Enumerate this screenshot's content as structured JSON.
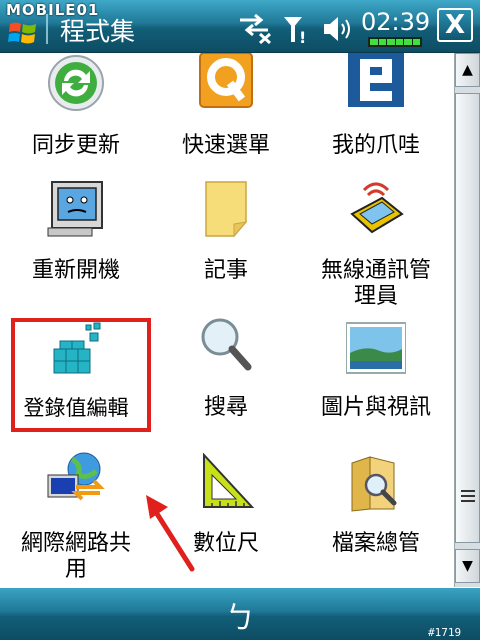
{
  "watermark": "MOBILE01",
  "title_bar": {
    "app_title": "程式集",
    "clock": "02:39",
    "close_label": "X"
  },
  "tiles": [
    {
      "id": "sync",
      "label": "同步更新",
      "icon": "sync-icon"
    },
    {
      "id": "quickmenu",
      "label": "快速選單",
      "icon": "quick-menu-icon"
    },
    {
      "id": "mywawa",
      "label": "我的爪哇",
      "icon": "java-icon"
    },
    {
      "id": "reset",
      "label": "重新開機",
      "icon": "reset-computer-icon"
    },
    {
      "id": "notes",
      "label": "記事",
      "icon": "notes-icon"
    },
    {
      "id": "wireless",
      "label_line1": "無線通訊管",
      "label_line2": "理員",
      "icon": "wireless-manager-icon"
    },
    {
      "id": "regedit",
      "label": "登錄值編輯",
      "icon": "registry-editor-icon"
    },
    {
      "id": "search",
      "label": "搜尋",
      "icon": "search-icon"
    },
    {
      "id": "pictures",
      "label": "圖片與視訊",
      "icon": "pictures-videos-icon"
    },
    {
      "id": "netshare",
      "label_line1": "網際網路共",
      "label_line2": "用",
      "icon": "internet-sharing-icon"
    },
    {
      "id": "ruler",
      "label": "數位尺",
      "icon": "ruler-icon"
    },
    {
      "id": "filemgr",
      "label": "檔案總管",
      "icon": "file-explorer-icon"
    }
  ],
  "bottom_bar": {
    "symbol": "ㄅ",
    "corner_id": "#1719"
  },
  "colors": {
    "bar_accent": "#1f7896",
    "highlight": "#e0201c"
  }
}
